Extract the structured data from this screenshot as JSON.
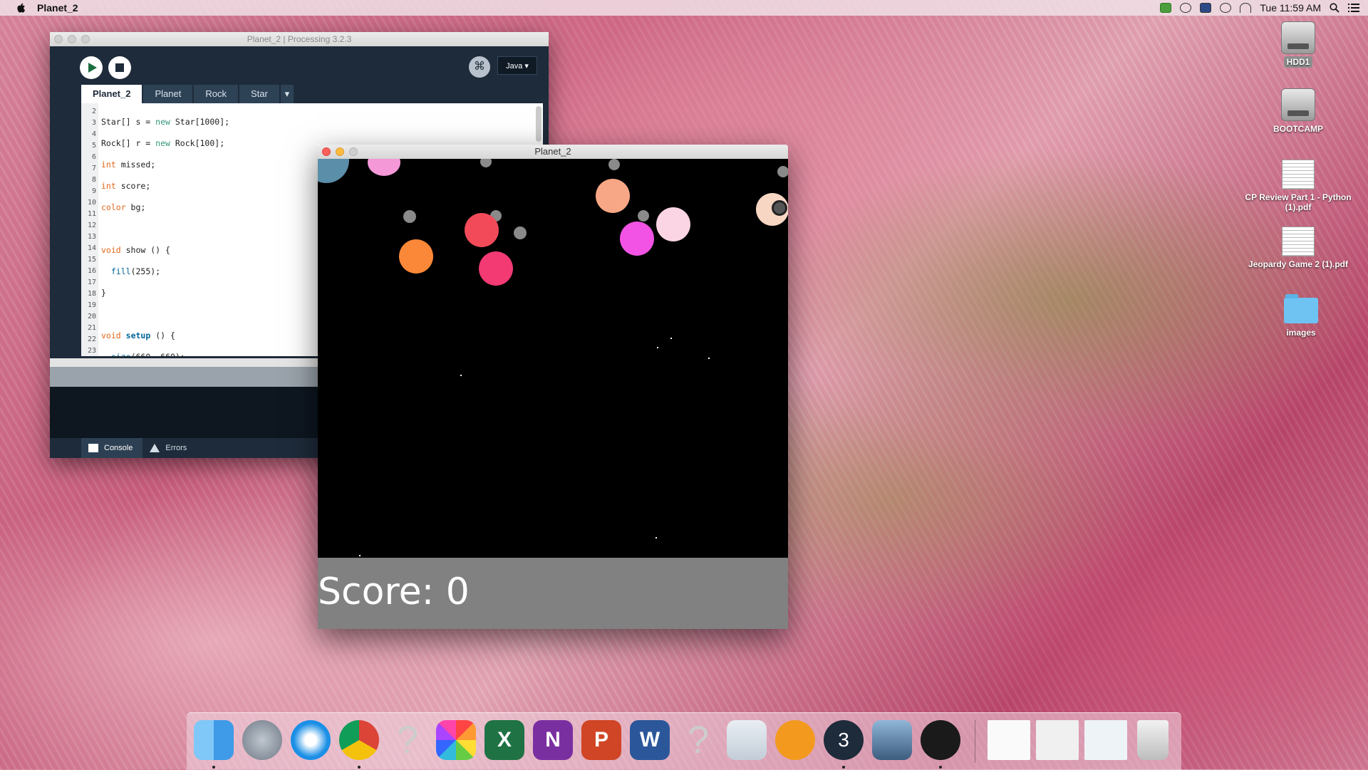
{
  "menubar": {
    "app_name": "Planet_2",
    "clock": "Tue 11:59 AM"
  },
  "desktop": {
    "items": [
      {
        "label": "HDD1",
        "kind": "disk"
      },
      {
        "label": "BOOTCAMP",
        "kind": "disk"
      },
      {
        "label": "CP Review Part 1 - Python (1).pdf",
        "kind": "pdf"
      },
      {
        "label": "Jeopardy Game 2 (1).pdf",
        "kind": "pdf"
      },
      {
        "label": "images",
        "kind": "folder"
      }
    ]
  },
  "ide": {
    "title": "Planet_2 | Processing 3.2.3",
    "mode": "Java ▾",
    "tabs": [
      "Planet_2",
      "Planet",
      "Rock",
      "Star",
      "▾"
    ],
    "line_numbers": [
      "2",
      "3",
      "4",
      "5",
      "6",
      "7",
      "8",
      "9",
      "10",
      "11",
      "12",
      "13",
      "14",
      "15",
      "16",
      "17",
      "18",
      "19",
      "20",
      "21",
      "22",
      "23"
    ],
    "console_tab": "Console",
    "errors_tab": "Errors"
  },
  "sketch": {
    "title": "Planet_2",
    "score_text": "Score: 0"
  },
  "dock": {
    "apps": [
      "finder-icon",
      "launchpad-icon",
      "safari-icon",
      "chrome-icon",
      "unknown-app-icon",
      "photos-icon",
      "excel-icon",
      "onenote-icon",
      "powerpoint-icon",
      "word-icon",
      "unknown-app-icon",
      "preview-icon",
      "ibooks-icon",
      "processing-icon",
      "image-capture-icon",
      "quicktime-icon"
    ],
    "colors": {
      "finder": "#3f9ae8",
      "safari": "#1b8fe6",
      "excel": "#1f7244",
      "onenote": "#7a2fa0",
      "powerpoint": "#d04525",
      "word": "#2b579a",
      "ibooks": "#f39a1e"
    }
  }
}
